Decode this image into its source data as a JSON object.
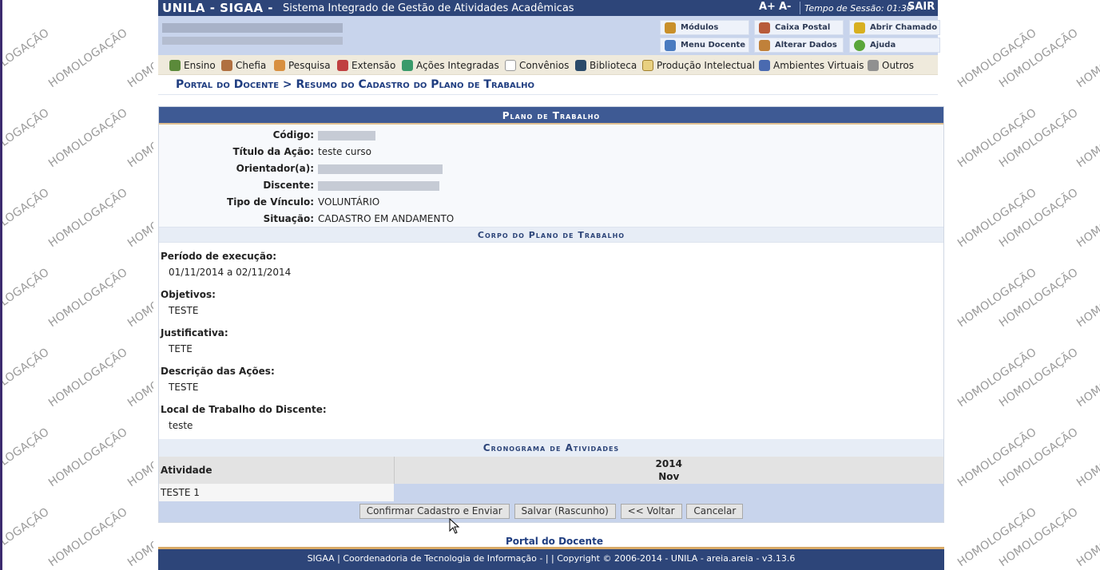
{
  "watermark": "HOMOLOGAÇÃO",
  "header": {
    "system_name": "UNILA - SIGAA -",
    "system_subtitle": "Sistema Integrado de Gestão de Atividades Acadêmicas",
    "font_increase": "A+",
    "font_decrease": "A-",
    "session_time": "Tempo de Sessão: 01:30",
    "logout": "SAIR"
  },
  "toolbar": {
    "modulos": "Módulos",
    "caixa_postal": "Caixa Postal",
    "abrir_chamado": "Abrir Chamado",
    "menu_docente": "Menu Docente",
    "alterar_dados": "Alterar Dados",
    "ajuda": "Ajuda"
  },
  "menu": {
    "items": [
      {
        "label": "Ensino",
        "icon": "books-icon"
      },
      {
        "label": "Chefia",
        "icon": "user-icon"
      },
      {
        "label": "Pesquisa",
        "icon": "flask-icon"
      },
      {
        "label": "Extensão",
        "icon": "handshake-icon"
      },
      {
        "label": "Ações Integradas",
        "icon": "puzzle-icon"
      },
      {
        "label": "Convênios",
        "icon": "documents-icon"
      },
      {
        "label": "Biblioteca",
        "icon": "library-icon"
      },
      {
        "label": "Produção Intelectual",
        "icon": "notepad-icon"
      },
      {
        "label": "Ambientes Virtuais",
        "icon": "network-icon"
      },
      {
        "label": "Outros",
        "icon": "gears-icon"
      }
    ]
  },
  "breadcrumb": "Portal do Docente > Resumo do Cadastro do Plano de Trabalho",
  "form": {
    "caption": "Plano de Trabalho",
    "fields": {
      "codigo_label": "Código:",
      "titulo_label": "Título da Ação:",
      "titulo_value": "teste curso",
      "orientador_label": "Orientador(a):",
      "discente_label": "Discente:",
      "vinculo_label": "Tipo de Vínculo:",
      "vinculo_value": "VOLUNTÁRIO",
      "situacao_label": "Situação:",
      "situacao_value": "CADASTRO EM ANDAMENTO"
    },
    "body_caption": "Corpo do Plano de Trabalho",
    "sections": {
      "periodo_label": "Período de execução:",
      "periodo_value": "01/11/2014 a 02/11/2014",
      "objetivos_label": "Objetivos:",
      "objetivos_value": "TESTE",
      "justificativa_label": "Justificativa:",
      "justificativa_value": "TETE",
      "descricao_label": "Descrição das Ações:",
      "descricao_value": "TESTE",
      "local_label": "Local de Trabalho do Discente:",
      "local_value": "teste"
    },
    "cronograma": {
      "caption": "Cronograma de Atividades",
      "col_atividade": "Atividade",
      "year": "2014",
      "month": "Nov",
      "activity": "TESTE 1"
    },
    "buttons": {
      "confirmar": "Confirmar Cadastro e Enviar",
      "salvar": "Salvar (Rascunho)",
      "voltar": "<< Voltar",
      "cancelar": "Cancelar"
    }
  },
  "portal_link": "Portal do Docente",
  "footer": "SIGAA | Coordenadoria de Tecnologia de Informação - | | Copyright © 2006-2014 - UNILA - areia.areia - v3.13.6"
}
